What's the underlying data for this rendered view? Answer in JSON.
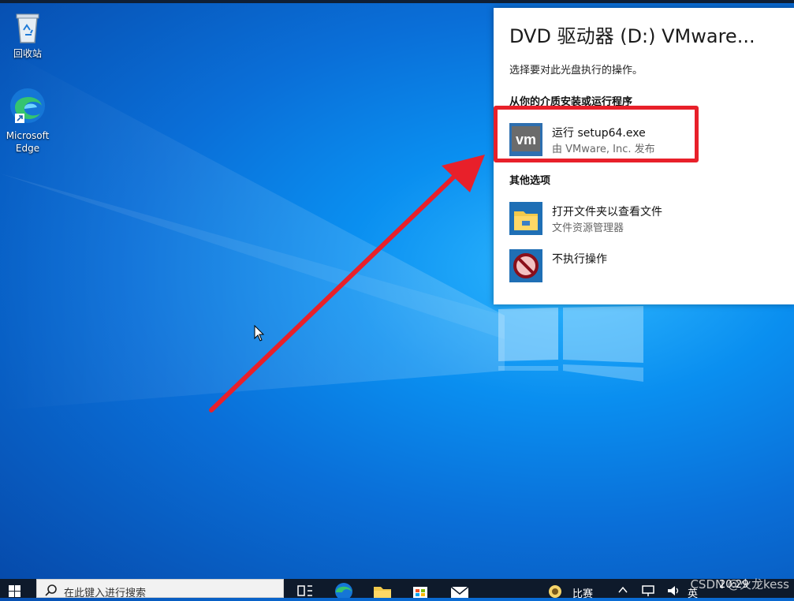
{
  "desktop": {
    "icons": [
      {
        "label": "回收站",
        "icon": "recycle-bin-icon"
      },
      {
        "label": "Microsoft Edge",
        "icon": "edge-icon"
      }
    ]
  },
  "autoplay": {
    "title": "DVD 驱动器 (D:) VMware...",
    "subtitle": "选择要对此光盘执行的操作。",
    "section_install": "从你的介质安装或运行程序",
    "run_option": {
      "title": "运行 setup64.exe",
      "subtitle": "由 VMware, Inc. 发布",
      "icon": "vmware-icon"
    },
    "section_other": "其他选项",
    "folder_option": {
      "title": "打开文件夹以查看文件",
      "subtitle": "文件资源管理器",
      "icon": "folder-icon"
    },
    "none_option": {
      "title": "不执行操作",
      "icon": "no-action-icon"
    }
  },
  "taskbar": {
    "search_placeholder": "在此键入进行搜索",
    "apps": [
      "task-view-icon",
      "edge-icon",
      "file-explorer-icon",
      "store-icon",
      "mail-icon"
    ],
    "news_label": "比赛",
    "ime": "英",
    "time": "20:29"
  },
  "watermark": "CSDN @火龙kess",
  "colors": {
    "highlight": "#e8202a",
    "arrow": "#e8202a",
    "taskbar": "#0e1a2b"
  }
}
